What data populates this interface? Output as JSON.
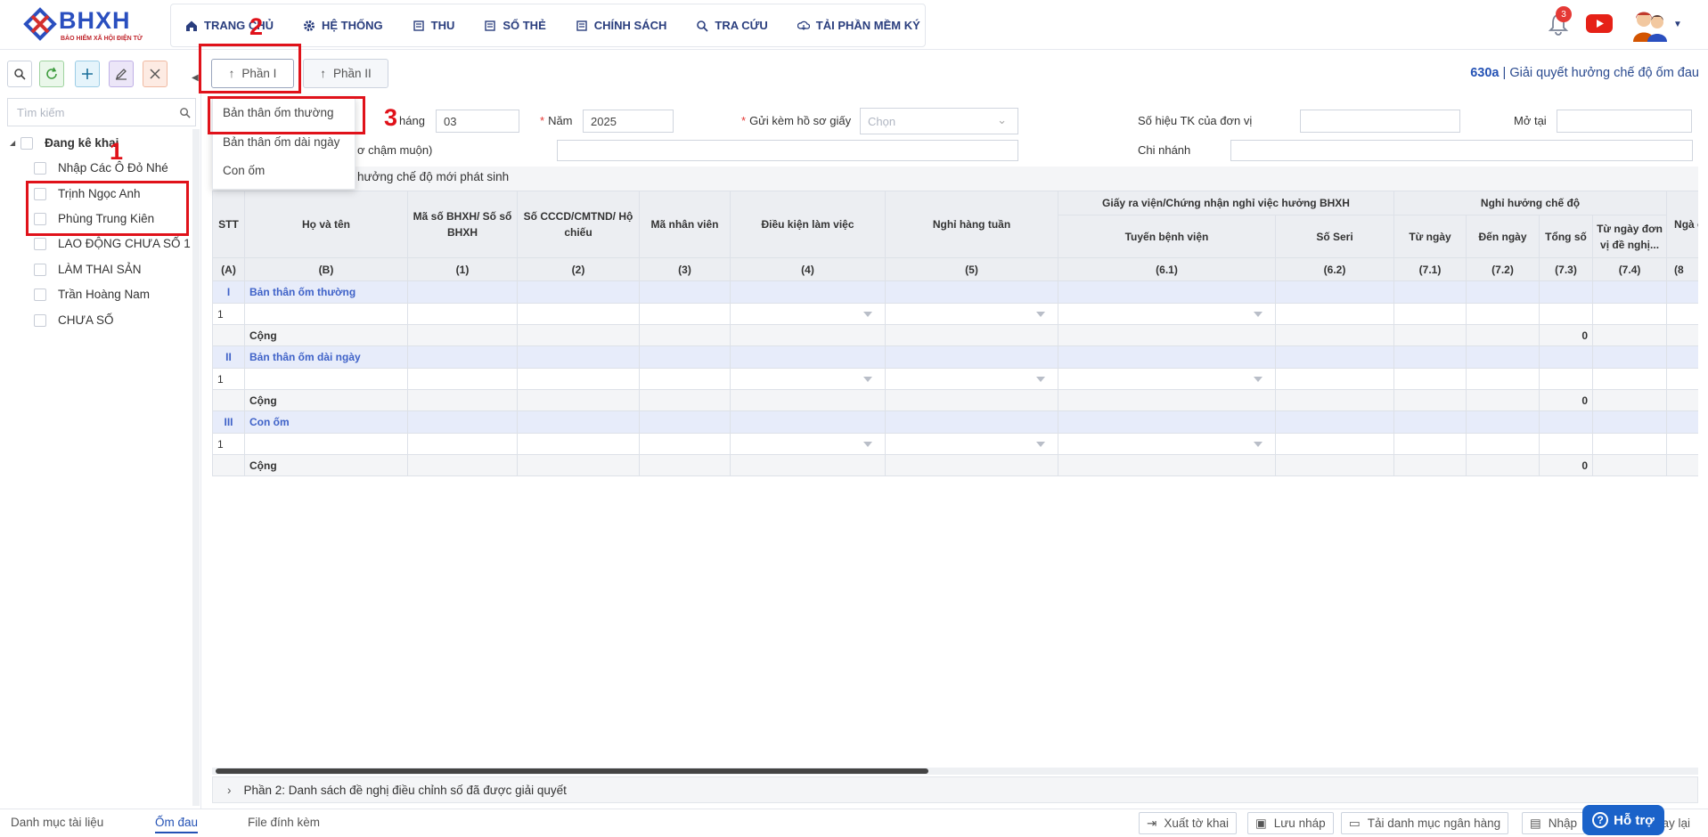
{
  "brand": {
    "logo_text": "BHXH",
    "logo_sub": "BẢO HIỂM XÃ HỘI ĐIỆN TỬ",
    "primary": "#2a4fbf",
    "danger": "#e0121a"
  },
  "nav": {
    "items": [
      {
        "label": "TRANG CHỦ",
        "icon": "home-icon"
      },
      {
        "label": "HỆ THỐNG",
        "icon": "gear-icon"
      },
      {
        "label": "THU",
        "icon": "document-icon"
      },
      {
        "label": "SỔ THẺ",
        "icon": "document-icon"
      },
      {
        "label": "CHÍNH SÁCH",
        "icon": "document-icon"
      },
      {
        "label": "TRA CỨU",
        "icon": "search-icon"
      },
      {
        "label": "TẢI PHẦN MỀM KÝ",
        "icon": "cloud-download-icon"
      }
    ],
    "notification_count": "3"
  },
  "sidebar": {
    "search_placeholder": "Tìm kiếm",
    "tree_root": "Đang kê khai",
    "items": [
      "Nhập Các Ô Đỏ Nhé",
      "Trịnh Ngọc Anh",
      "Phùng Trung Kiên",
      "LAO ĐỘNG CHƯA SỐ 1",
      "LÀM THAI SẢN",
      "Trần Hoàng Nam",
      "CHƯA SỐ"
    ]
  },
  "phases": {
    "p1": "Phần I",
    "p2": "Phần II"
  },
  "form_title": {
    "code": "630a",
    "sep": " | ",
    "name": "Giải quyết hưởng chế độ ốm đau"
  },
  "form": {
    "thang_label": "háng",
    "thang_value": "03",
    "nam_label": "Năm",
    "nam_value": "2025",
    "gui_kem_label": "Gửi kèm hồ sơ giấy",
    "gui_kem_placeholder": "Chọn",
    "so_hieu_label": "Số hiệu TK của đơn vị",
    "mo_tai_label": "Mở tại",
    "cham_muon_label": "ơ chậm muộn)",
    "chi_nhanh_label": "Chi nhánh",
    "section_caption": "hưởng chế độ mới phát sinh"
  },
  "dropdown": {
    "items": [
      "Bản thân ốm thường",
      "Bản thân ốm dài ngày",
      "Con ốm"
    ]
  },
  "table": {
    "h": {
      "stt": "STT",
      "ho_ten": "Họ và tên",
      "ma_so": "Mã số BHXH/ Số sổ BHXH",
      "cccd": "Số CCCD/CMTND/ Hộ chiếu",
      "ma_nv": "Mã nhân viên",
      "dieu_kien": "Điều kiện làm việc",
      "nghi_tuan": "Nghỉ hàng tuần",
      "giay": "Giấy ra viện/Chứng nhận nghỉ việc hưởng BHXH",
      "tuyen": "Tuyến bệnh viện",
      "seri": "Số Seri",
      "nghi_huong": "Nghỉ hưởng chế độ",
      "tu_ngay": "Từ ngày",
      "den_ngay": "Đến ngày",
      "tong_so": "Tổng số",
      "tu_ngay_dv": "Từ ngày đơn vị đề nghị...",
      "ngay_c": "Ngà c"
    },
    "idx": [
      "(A)",
      "(B)",
      "(1)",
      "(2)",
      "(3)",
      "(4)",
      "(5)",
      "(6.1)",
      "(6.2)",
      "(7.1)",
      "(7.2)",
      "(7.3)",
      "(7.4)",
      "(8"
    ],
    "groups": [
      {
        "roman": "I",
        "title": "Bản thân ốm thường",
        "row": "1",
        "sum_label": "Cộng",
        "sum_value": "0"
      },
      {
        "roman": "II",
        "title": "Bản thân ốm dài ngày",
        "row": "1",
        "sum_label": "Cộng",
        "sum_value": "0"
      },
      {
        "roman": "III",
        "title": "Con ốm",
        "row": "1",
        "sum_label": "Cộng",
        "sum_value": "0"
      }
    ]
  },
  "part2_label": "Phần 2: Danh sách đề nghị điều chỉnh số đã được giải quyết",
  "bottom": {
    "tabs": [
      "Danh mục tài liệu",
      "Ốm đau",
      "File đính kèm"
    ],
    "buttons": [
      "Xuất tờ khai",
      "Lưu nháp",
      "Tải danh mục ngân hàng",
      "Nhập"
    ],
    "back": "uay lại",
    "support": "Hỗ trợ"
  },
  "annotations": [
    "1",
    "2",
    "3"
  ]
}
